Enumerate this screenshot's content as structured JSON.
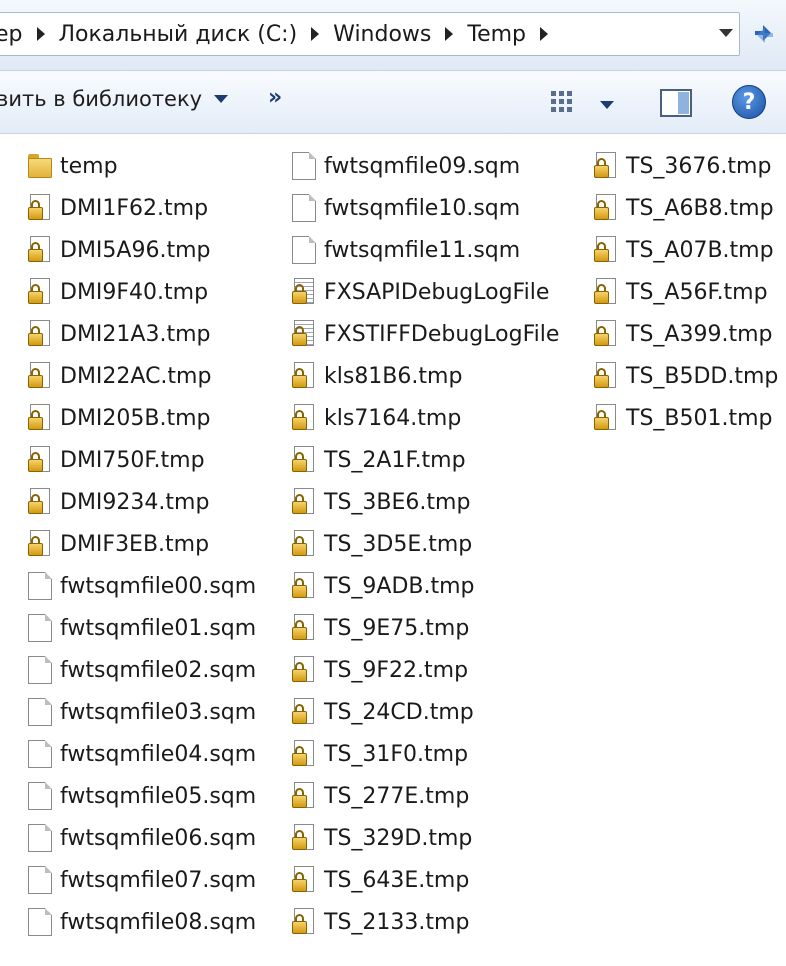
{
  "address_bar": {
    "crumbs": [
      "ер",
      "Локальный диск (C:)",
      "Windows",
      "Temp"
    ],
    "refresh_icon": "refresh-icon"
  },
  "toolbar": {
    "library_label": "вить в библиотеку",
    "more_label": "»",
    "help_label": "?"
  },
  "colors": {
    "accent": "#2a64b7",
    "toolbar_bg": "#e3ecf7"
  },
  "files": {
    "col1": [
      {
        "name": "temp",
        "icon": "folder-icon"
      },
      {
        "name": "DMI1F62.tmp",
        "icon": "locked-file-icon"
      },
      {
        "name": "DMI5A96.tmp",
        "icon": "locked-file-icon"
      },
      {
        "name": "DMI9F40.tmp",
        "icon": "locked-file-icon"
      },
      {
        "name": "DMI21A3.tmp",
        "icon": "locked-file-icon"
      },
      {
        "name": "DMI22AC.tmp",
        "icon": "locked-file-icon"
      },
      {
        "name": "DMI205B.tmp",
        "icon": "locked-file-icon"
      },
      {
        "name": "DMI750F.tmp",
        "icon": "locked-file-icon"
      },
      {
        "name": "DMI9234.tmp",
        "icon": "locked-file-icon"
      },
      {
        "name": "DMIF3EB.tmp",
        "icon": "locked-file-icon"
      },
      {
        "name": "fwtsqmfile00.sqm",
        "icon": "file-icon"
      },
      {
        "name": "fwtsqmfile01.sqm",
        "icon": "file-icon"
      },
      {
        "name": "fwtsqmfile02.sqm",
        "icon": "file-icon"
      },
      {
        "name": "fwtsqmfile03.sqm",
        "icon": "file-icon"
      },
      {
        "name": "fwtsqmfile04.sqm",
        "icon": "file-icon"
      },
      {
        "name": "fwtsqmfile05.sqm",
        "icon": "file-icon"
      },
      {
        "name": "fwtsqmfile06.sqm",
        "icon": "file-icon"
      },
      {
        "name": "fwtsqmfile07.sqm",
        "icon": "file-icon"
      },
      {
        "name": "fwtsqmfile08.sqm",
        "icon": "file-icon"
      }
    ],
    "col2": [
      {
        "name": "fwtsqmfile09.sqm",
        "icon": "file-icon"
      },
      {
        "name": "fwtsqmfile10.sqm",
        "icon": "file-icon"
      },
      {
        "name": "fwtsqmfile11.sqm",
        "icon": "file-icon"
      },
      {
        "name": "FXSAPIDebugLogFile",
        "icon": "log-file-icon"
      },
      {
        "name": "FXSTIFFDebugLogFile",
        "icon": "log-file-icon"
      },
      {
        "name": "kls81B6.tmp",
        "icon": "locked-file-icon"
      },
      {
        "name": "kls7164.tmp",
        "icon": "locked-file-icon"
      },
      {
        "name": "TS_2A1F.tmp",
        "icon": "locked-file-icon"
      },
      {
        "name": "TS_3BE6.tmp",
        "icon": "locked-file-icon"
      },
      {
        "name": "TS_3D5E.tmp",
        "icon": "locked-file-icon"
      },
      {
        "name": "TS_9ADB.tmp",
        "icon": "locked-file-icon"
      },
      {
        "name": "TS_9E75.tmp",
        "icon": "locked-file-icon"
      },
      {
        "name": "TS_9F22.tmp",
        "icon": "locked-file-icon"
      },
      {
        "name": "TS_24CD.tmp",
        "icon": "locked-file-icon"
      },
      {
        "name": "TS_31F0.tmp",
        "icon": "locked-file-icon"
      },
      {
        "name": "TS_277E.tmp",
        "icon": "locked-file-icon"
      },
      {
        "name": "TS_329D.tmp",
        "icon": "locked-file-icon"
      },
      {
        "name": "TS_643E.tmp",
        "icon": "locked-file-icon"
      },
      {
        "name": "TS_2133.tmp",
        "icon": "locked-file-icon"
      }
    ],
    "col3": [
      {
        "name": "TS_3676.tmp",
        "icon": "locked-file-icon"
      },
      {
        "name": "TS_A6B8.tmp",
        "icon": "locked-file-icon"
      },
      {
        "name": "TS_A07B.tmp",
        "icon": "locked-file-icon"
      },
      {
        "name": "TS_A56F.tmp",
        "icon": "locked-file-icon"
      },
      {
        "name": "TS_A399.tmp",
        "icon": "locked-file-icon"
      },
      {
        "name": "TS_B5DD.tmp",
        "icon": "locked-file-icon"
      },
      {
        "name": "TS_B501.tmp",
        "icon": "locked-file-icon"
      }
    ]
  }
}
